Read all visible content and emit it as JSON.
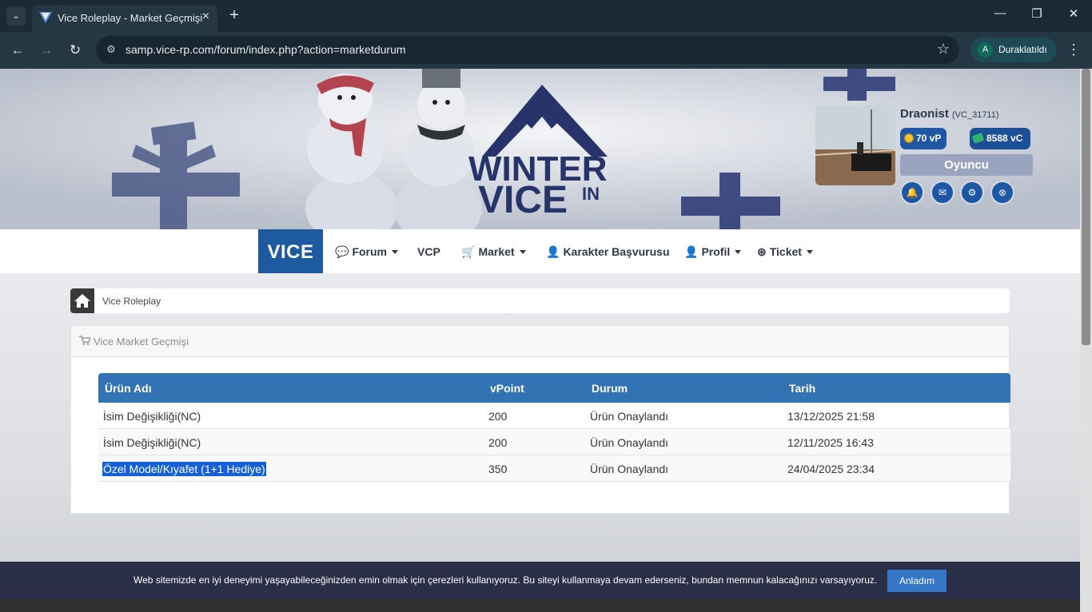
{
  "browser": {
    "tab_title": "Vice Roleplay - Market Geçmişi",
    "url": "samp.vice-rp.com/forum/index.php?action=marketdurum",
    "profile_initial": "A",
    "profile_label": "Duraklatıldı"
  },
  "banner": {
    "logo_line1": "WINTER",
    "logo_line2": "VICE",
    "logo_suffix": "IN"
  },
  "user": {
    "name": "Draonist",
    "id": "(VC_31711)",
    "vp": "70 vP",
    "vc": "8588 vC",
    "role": "Oyuncu"
  },
  "nav": {
    "brand": "VICE",
    "items": [
      {
        "label": "Forum",
        "icon": "comments-icon"
      },
      {
        "label": "VCP"
      },
      {
        "label": "Market",
        "icon": "cart-icon"
      },
      {
        "label": "Karakter Başvurusu",
        "icon": "user-plus-icon"
      },
      {
        "label": "Profil",
        "icon": "user-icon"
      },
      {
        "label": "Ticket",
        "icon": "lifering-icon"
      }
    ]
  },
  "breadcrumb": {
    "item": "Vice Roleplay"
  },
  "panel": {
    "title": "Vice Market Geçmişi"
  },
  "table": {
    "headers": [
      "Ürün Adı",
      "vPoint",
      "Durum",
      "Tarih"
    ],
    "rows": [
      [
        "İsim Değişikliği(NC)",
        "200",
        "Ürün Onaylandı",
        "13/12/2025 21:58"
      ],
      [
        "İsim Değişikliği(NC)",
        "200",
        "Ürün Onaylandı",
        "12/11/2025 16:43"
      ],
      [
        "Özel Model/Kıyafet (1+1 Hediye)",
        "350",
        "Ürün Onaylandı",
        "24/04/2025 23:34"
      ]
    ]
  },
  "cookie": {
    "text": "Web sitemizde en iyi deneyimi yaşayabileceğinizden emin olmak için çerezleri kullanıyoruz. Bu siteyi kullanmaya devam ederseniz, bundan memnun kalacağınızı varsayıyoruz.",
    "button": "Anladım"
  },
  "colors": {
    "brand_blue": "#1e5aa0",
    "table_header": "#3273b4",
    "cookie_bar": "#242842"
  }
}
